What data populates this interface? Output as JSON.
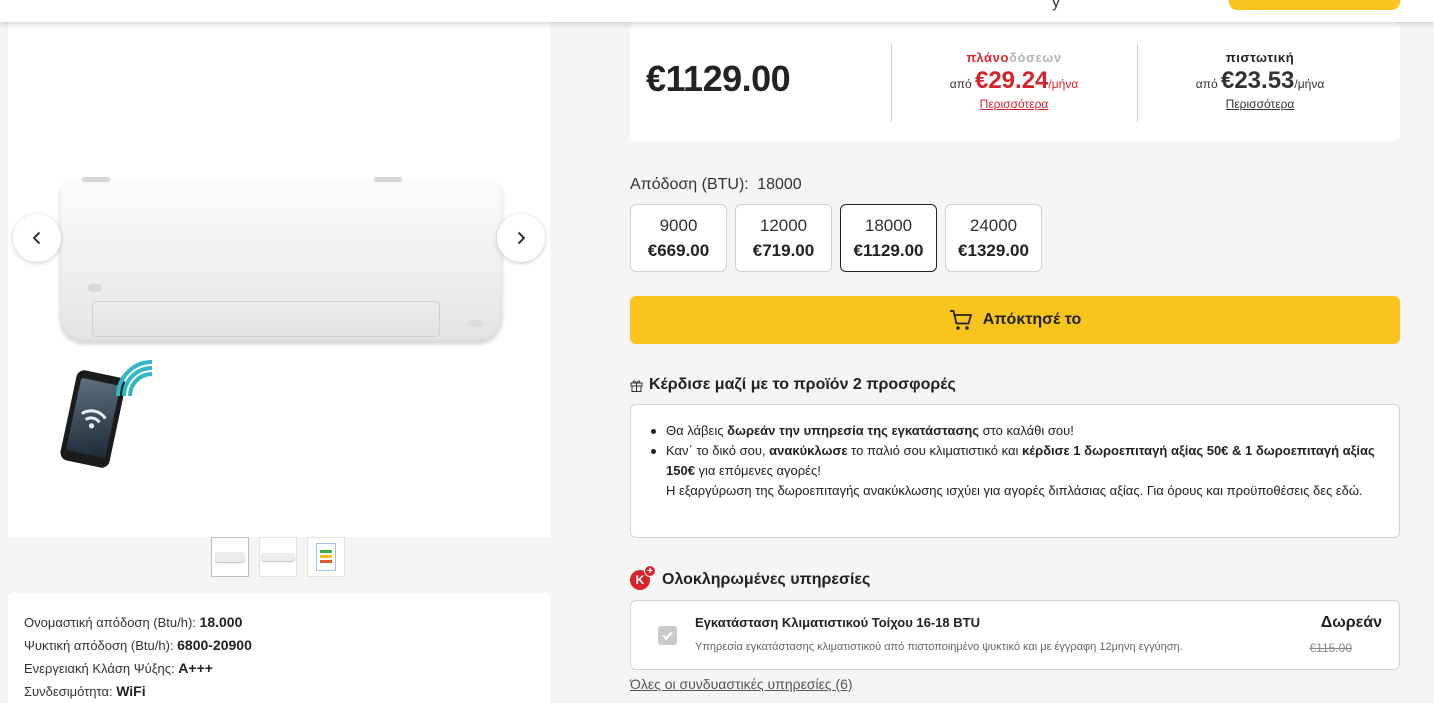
{
  "header": {
    "fragment": "y"
  },
  "gallery": {
    "prev_icon": "chevron-left-icon",
    "next_icon": "chevron-right-icon",
    "thumbnails": [
      "indoor-unit-front",
      "indoor-unit-side",
      "energy-label"
    ]
  },
  "specs": [
    {
      "label": "Ονομαστική απόδοση (Btu/h): ",
      "value": "18.000"
    },
    {
      "label": "Ψυκτική απόδοση (Btu/h): ",
      "value": "6800-20900"
    },
    {
      "label": "Ενεργειακή Κλάση Ψύξης: ",
      "value": "A+++"
    },
    {
      "label": "Συνδεσιμότητα: ",
      "value": "WiFi"
    }
  ],
  "price": {
    "main": "€1129.00",
    "plano_red": "πλάνο",
    "plano_grey": "δόσεων",
    "plano_from": "από ",
    "plano_amount": "€29.24",
    "plano_suffix": "/μήνα",
    "plano_link": "Περισσότερα",
    "credit_title": "πιστωτική",
    "credit_from": "από ",
    "credit_amount": "€23.53",
    "credit_suffix": "/μήνα",
    "credit_link": "Περισσότερα"
  },
  "btu": {
    "label": "Απόδοση (BTU):",
    "selected": "18000",
    "variants": [
      {
        "btu": "9000",
        "price": "€669.00"
      },
      {
        "btu": "12000",
        "price": "€719.00"
      },
      {
        "btu": "18000",
        "price": "€1129.00"
      },
      {
        "btu": "24000",
        "price": "€1329.00"
      }
    ]
  },
  "buy_button": {
    "label": "Απόκτησέ το",
    "icon": "cart-icon"
  },
  "offers": {
    "title": "Κέρδισε μαζί με το προϊόν 2 προσφορές",
    "icon": "gift-icon",
    "o1_a": "Θα λάβεις ",
    "o1_b": "δωρεάν την υπηρεσία της εγκατάστασης",
    "o1_c": " στο καλάθι σου!",
    "o2_a": "Καν΄ το δικό σου, ",
    "o2_b": "ανακύκλωσε",
    "o2_c": " το παλιό σου κλιματιστικό και ",
    "o2_d": "κέρδισε 1 δωροεπιταγή αξίας 50€ & 1 δωροεπιταγή αξίας 150€",
    "o2_e": " για επόμενες αγορές!",
    "o3": "Η εξαργύρωση της δωροεπιταγής ανακύκλωσης ισχύει για αγορές διπλάσιας αξίας. Για όρους και προϋποθέσεις δες εδώ."
  },
  "services": {
    "title": "Ολοκληρωμένες υπηρεσίες",
    "badge": "K",
    "badge_plus": "+",
    "item": {
      "name": "Εγκατάσταση Κλιματιστικού Τοίχου 16-18 BTU",
      "desc": "Υπηρεσία εγκατάστασης κλιματιστικού από πιστοποιημένο ψυκτικό και με έγγραφη 12μηνη εγγύηση.",
      "price": "Δωρεάν",
      "old_price": "€115.00",
      "checked": true
    },
    "all_link": "Όλες οι συνδυαστικές υπηρεσίες (6)"
  },
  "colors": {
    "accent": "#f9c51c",
    "brand_red": "#d5232a",
    "text": "#222222"
  }
}
